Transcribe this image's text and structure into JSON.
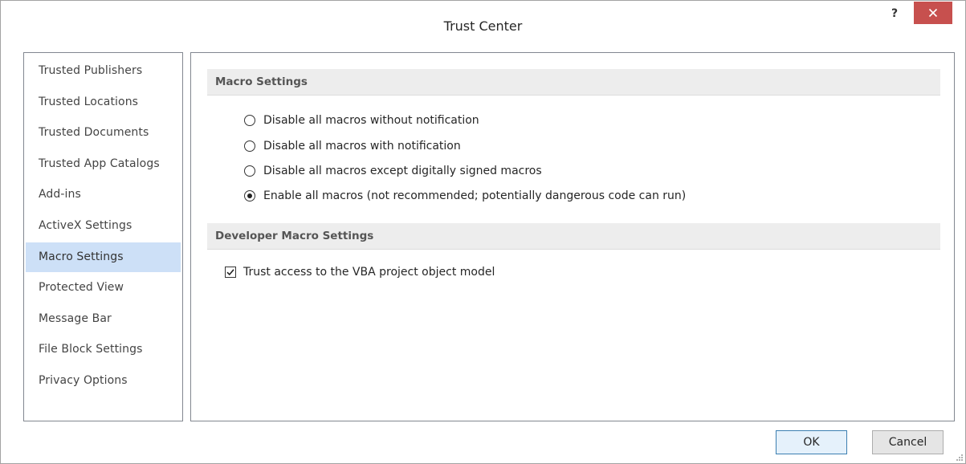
{
  "window": {
    "title": "Trust Center",
    "help_label": "?",
    "close_icon": "close-icon"
  },
  "sidebar": {
    "items": [
      {
        "label": "Trusted Publishers",
        "selected": false
      },
      {
        "label": "Trusted Locations",
        "selected": false
      },
      {
        "label": "Trusted Documents",
        "selected": false
      },
      {
        "label": "Trusted App Catalogs",
        "selected": false
      },
      {
        "label": "Add-ins",
        "selected": false
      },
      {
        "label": "ActiveX Settings",
        "selected": false
      },
      {
        "label": "Macro Settings",
        "selected": true
      },
      {
        "label": "Protected View",
        "selected": false
      },
      {
        "label": "Message Bar",
        "selected": false
      },
      {
        "label": "File Block Settings",
        "selected": false
      },
      {
        "label": "Privacy Options",
        "selected": false
      }
    ]
  },
  "macro_settings": {
    "header": "Macro Settings",
    "options": [
      {
        "label": "Disable all macros without notification",
        "checked": false
      },
      {
        "label": "Disable all macros with notification",
        "checked": false
      },
      {
        "label": "Disable all macros except digitally signed macros",
        "checked": false
      },
      {
        "label": "Enable all macros (not recommended; potentially dangerous code can run)",
        "checked": true
      }
    ]
  },
  "developer_settings": {
    "header": "Developer Macro Settings",
    "vba_access_label": "Trust access to the VBA project object model",
    "vba_access_checked": true
  },
  "buttons": {
    "ok": "OK",
    "cancel": "Cancel"
  },
  "colors": {
    "selected_item_bg": "#cde0f7",
    "close_button_bg": "#c7504e",
    "section_header_bg": "#ededed"
  }
}
